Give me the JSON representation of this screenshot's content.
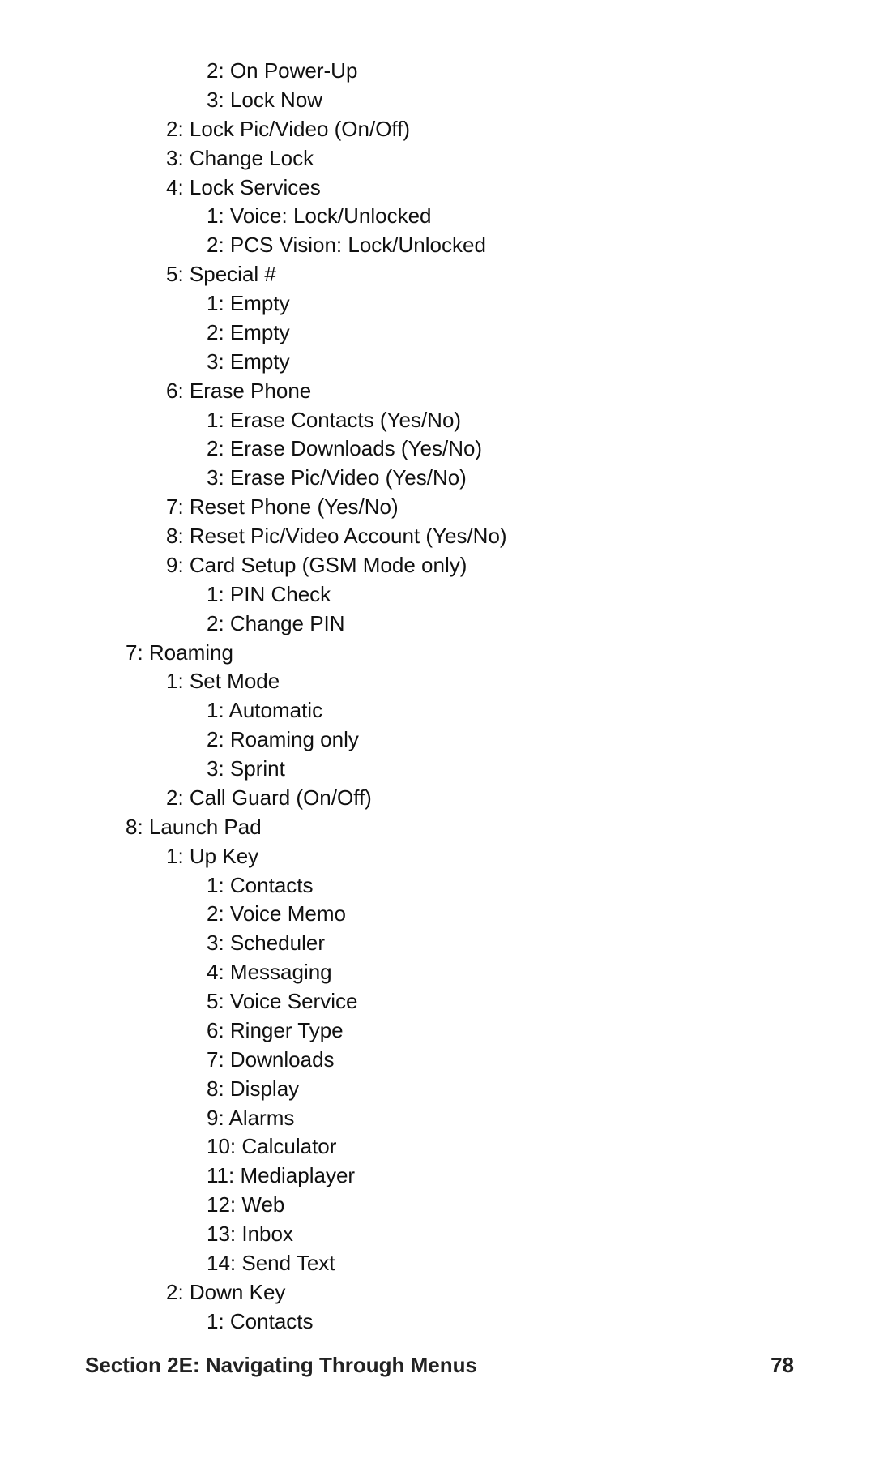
{
  "footer": {
    "section": "Section 2E: Navigating Through Menus",
    "page": "78"
  },
  "lines": [
    {
      "indent": 3,
      "text": "2: On Power-Up"
    },
    {
      "indent": 3,
      "text": "3: Lock Now"
    },
    {
      "indent": 2,
      "text": "2: Lock Pic/Video (On/Off)"
    },
    {
      "indent": 2,
      "text": "3: Change Lock"
    },
    {
      "indent": 2,
      "text": "4: Lock Services"
    },
    {
      "indent": 3,
      "text": "1: Voice: Lock/Unlocked"
    },
    {
      "indent": 3,
      "text": "2: PCS Vision: Lock/Unlocked"
    },
    {
      "indent": 2,
      "text": "5: Special #"
    },
    {
      "indent": 3,
      "text": "1: Empty"
    },
    {
      "indent": 3,
      "text": "2: Empty"
    },
    {
      "indent": 3,
      "text": "3: Empty"
    },
    {
      "indent": 2,
      "text": "6: Erase Phone"
    },
    {
      "indent": 3,
      "text": "1: Erase Contacts (Yes/No)"
    },
    {
      "indent": 3,
      "text": "2: Erase Downloads (Yes/No)"
    },
    {
      "indent": 3,
      "text": "3: Erase Pic/Video (Yes/No)"
    },
    {
      "indent": 2,
      "text": "7: Reset Phone (Yes/No)"
    },
    {
      "indent": 2,
      "text": "8: Reset Pic/Video Account (Yes/No)"
    },
    {
      "indent": 2,
      "text": "9: Card Setup (GSM Mode only)"
    },
    {
      "indent": 3,
      "text": "1: PIN Check"
    },
    {
      "indent": 3,
      "text": "2: Change PIN"
    },
    {
      "indent": 1,
      "text": "7: Roaming"
    },
    {
      "indent": 2,
      "text": "1: Set Mode"
    },
    {
      "indent": 3,
      "text": "1: Automatic"
    },
    {
      "indent": 3,
      "text": "2: Roaming only"
    },
    {
      "indent": 3,
      "text": "3: Sprint"
    },
    {
      "indent": 2,
      "text": "2: Call Guard (On/Off)"
    },
    {
      "indent": 1,
      "text": "8: Launch Pad"
    },
    {
      "indent": 2,
      "text": "1: Up Key"
    },
    {
      "indent": 3,
      "text": "1: Contacts"
    },
    {
      "indent": 3,
      "text": "2: Voice Memo"
    },
    {
      "indent": 3,
      "text": "3: Scheduler"
    },
    {
      "indent": 3,
      "text": "4: Messaging"
    },
    {
      "indent": 3,
      "text": "5: Voice Service"
    },
    {
      "indent": 3,
      "text": "6: Ringer Type"
    },
    {
      "indent": 3,
      "text": "7: Downloads"
    },
    {
      "indent": 3,
      "text": "8: Display"
    },
    {
      "indent": 3,
      "text": "9: Alarms"
    },
    {
      "indent": 3,
      "text": "10: Calculator"
    },
    {
      "indent": 3,
      "text": "11: Mediaplayer"
    },
    {
      "indent": 3,
      "text": "12: Web"
    },
    {
      "indent": 3,
      "text": "13: Inbox"
    },
    {
      "indent": 3,
      "text": "14: Send Text"
    },
    {
      "indent": 2,
      "text": "2: Down Key"
    },
    {
      "indent": 3,
      "text": "1: Contacts"
    }
  ]
}
